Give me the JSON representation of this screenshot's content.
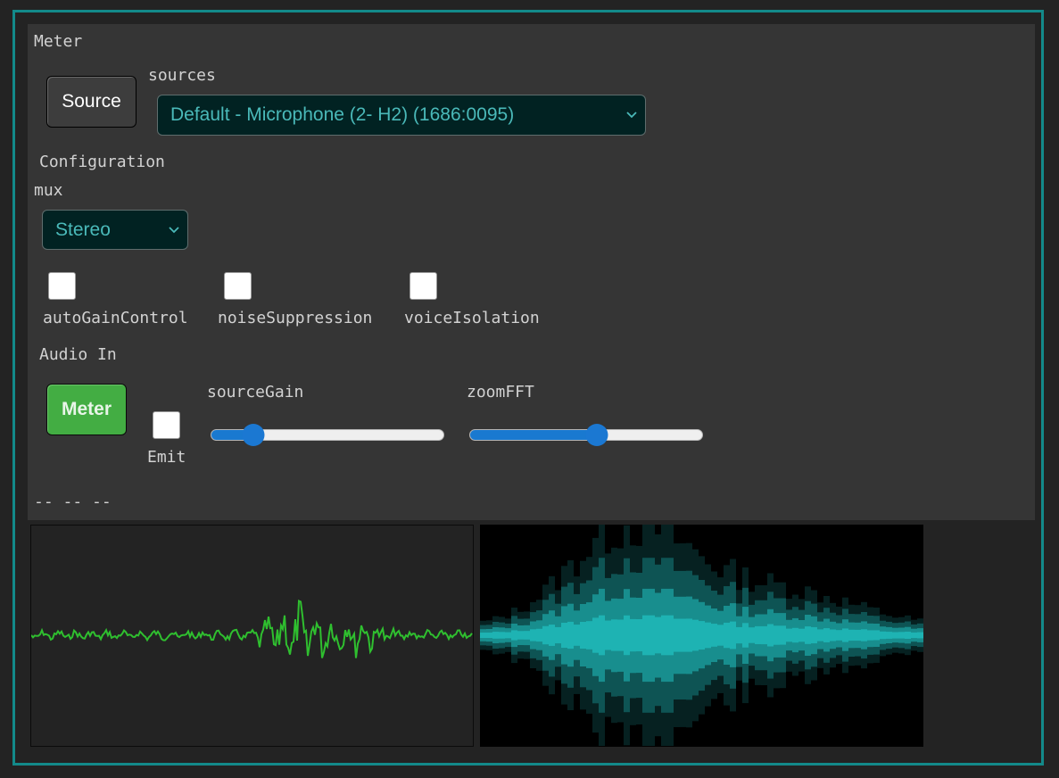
{
  "meter": {
    "title": "Meter",
    "source_button": "Source",
    "sources_label": "sources",
    "sources_selected": "Default - Microphone (2- H2) (1686:0095)",
    "configuration_label": "Configuration",
    "mux_label": "mux",
    "mux_selected": "Stereo",
    "checkboxes": [
      {
        "label": "autoGainControl",
        "checked": false
      },
      {
        "label": "noiseSuppression",
        "checked": false
      },
      {
        "label": "voiceIsolation",
        "checked": false
      }
    ],
    "audio_in_label": "Audio In",
    "meter_button": "Meter",
    "emit_label": "Emit",
    "emit_checked": false,
    "source_gain_label": "sourceGain",
    "source_gain_value": 0.15,
    "zoom_fft_label": "zoomFFT",
    "zoom_fft_value": 0.55,
    "status_text": "-- -- --"
  },
  "colors": {
    "frame": "#138a8a",
    "waveform": "#2fbf2f",
    "spectrum": "#1fb5b5",
    "meter_button": "#43ad43",
    "select_text": "#4ab9b9"
  }
}
